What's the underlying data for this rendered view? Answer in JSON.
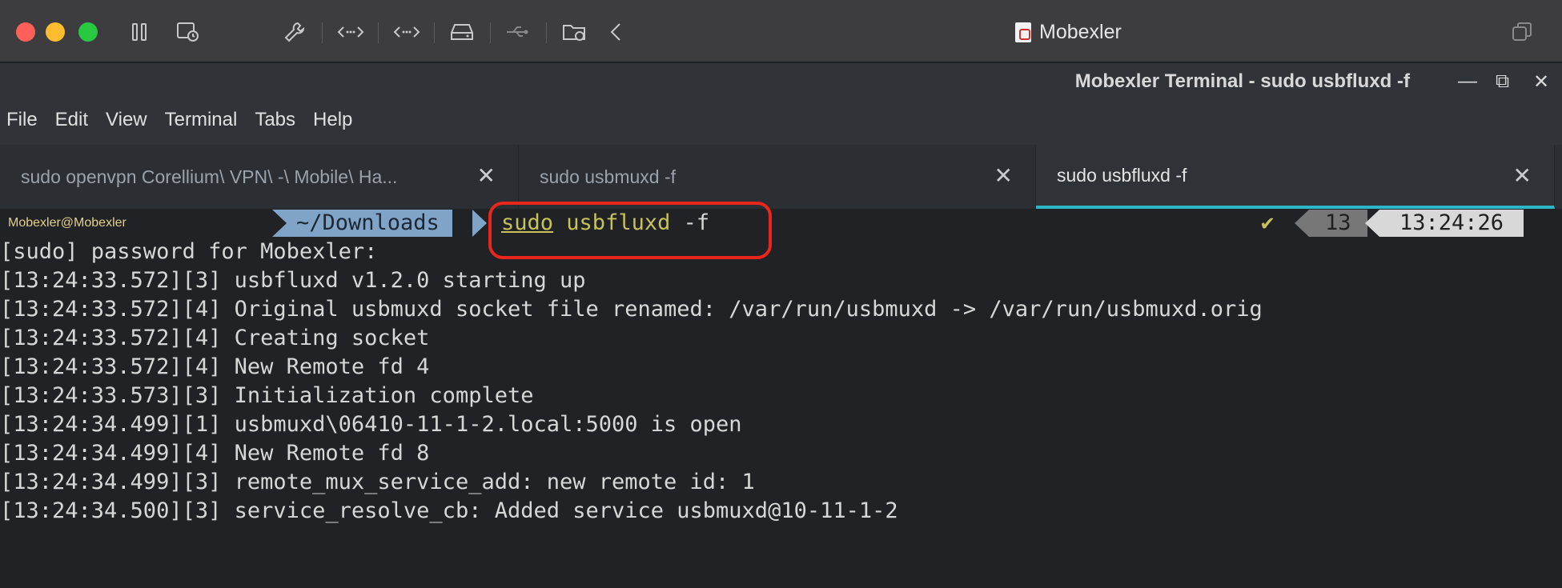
{
  "mac": {
    "title": "Mobexler"
  },
  "window": {
    "title": "Mobexler Terminal - sudo usbfluxd -f",
    "controls": [
      "—",
      "⧉",
      "✕"
    ]
  },
  "menu": [
    "File",
    "Edit",
    "View",
    "Terminal",
    "Tabs",
    "Help"
  ],
  "tabs": [
    {
      "label": "sudo openvpn Corellium\\ VPN\\ -\\ Mobile\\ Ha...",
      "active": false
    },
    {
      "label": "sudo usbmuxd -f",
      "active": false
    },
    {
      "label": "sudo usbfluxd -f",
      "active": true
    }
  ],
  "prompt": {
    "user": "Mobexler@Mobexler",
    "path": "~/Downloads",
    "cmd_sudo": "sudo",
    "cmd_bin": "usbfluxd",
    "cmd_args": "-f",
    "check": "✔",
    "count": "13",
    "time": "13:24:26"
  },
  "output": [
    "[sudo] password for Mobexler:",
    "[13:24:33.572][3] usbfluxd v1.2.0 starting up",
    "[13:24:33.572][4] Original usbmuxd socket file renamed: /var/run/usbmuxd -> /var/run/usbmuxd.orig",
    "[13:24:33.572][4] Creating socket",
    "[13:24:33.572][4] New Remote fd 4",
    "[13:24:33.573][3] Initialization complete",
    "[13:24:34.499][1] usbmuxd\\06410-11-1-2.local:5000 is open",
    "[13:24:34.499][4] New Remote fd 8",
    "[13:24:34.499][3] remote_mux_service_add: new remote id: 1",
    "[13:24:34.500][3] service_resolve_cb: Added service usbmuxd@10-11-1-2"
  ],
  "colors": {
    "accent": "#2bb6c9",
    "highlight": "#e8261c",
    "path_bg": "#7fa4c8"
  }
}
